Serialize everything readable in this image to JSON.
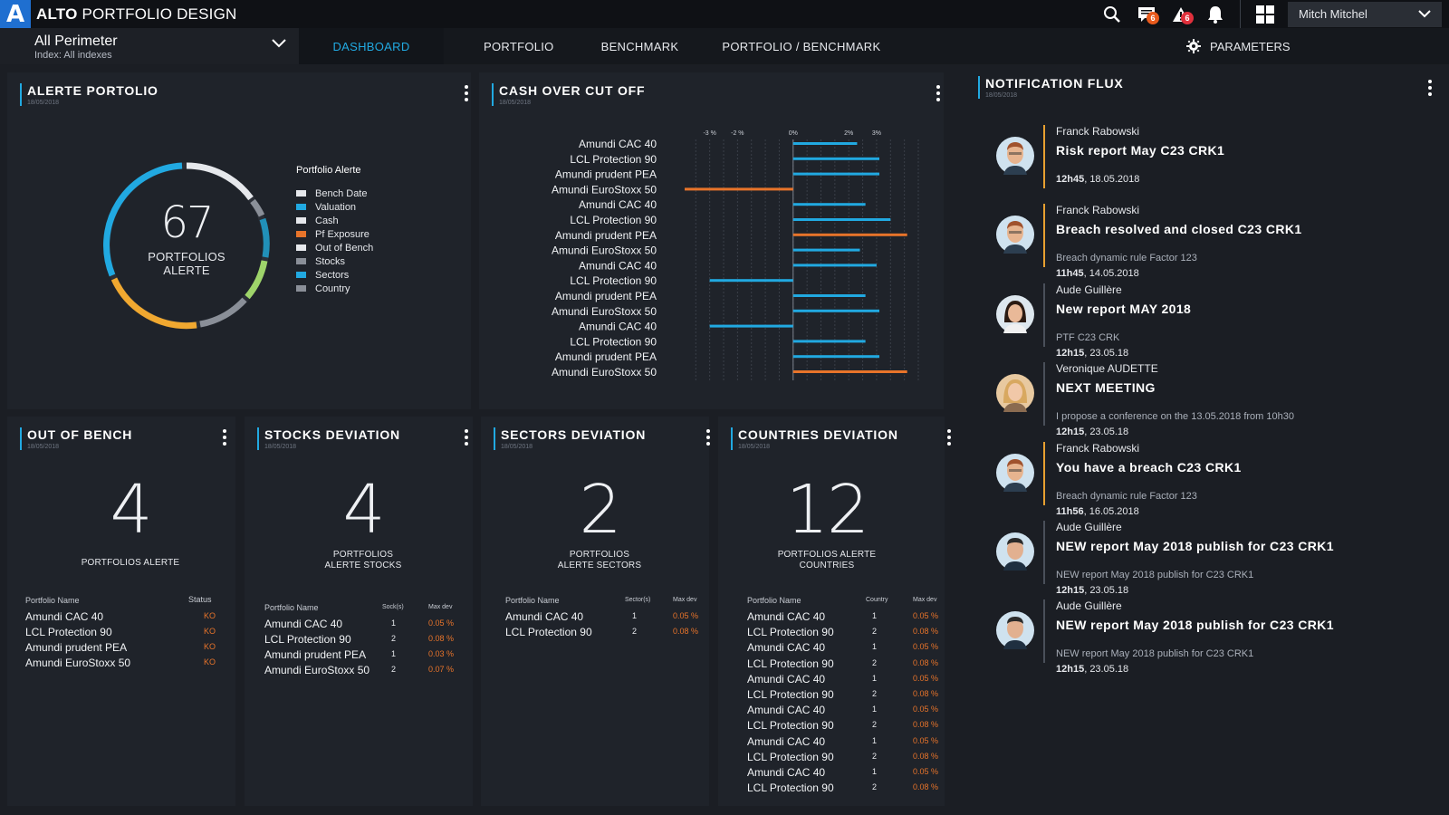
{
  "app": {
    "logo_letter": "A",
    "brand_bold": "ALTO",
    "brand_rest": "PORTFOLIO DESIGN"
  },
  "topbar": {
    "icons": [
      {
        "name": "search-icon"
      },
      {
        "name": "messages-icon",
        "badge": "6"
      },
      {
        "name": "alert-icon",
        "badge": "6"
      },
      {
        "name": "bell-icon"
      },
      {
        "name": "apps-grid-icon"
      }
    ],
    "user": "Mitch Mitchel"
  },
  "perimeter": {
    "title": "All Perimeter",
    "subtitle": "Index:  All indexes"
  },
  "nav": {
    "tabs": [
      "DASHBOARD",
      "PORTFOLIO",
      "BENCHMARK",
      "PORTFOLIO / BENCHMARK"
    ],
    "active": "DASHBOARD",
    "parameters": "PARAMETERS"
  },
  "alerte": {
    "title": "ALERTE PORTOLIO",
    "date": "18/05/2018",
    "count": "67",
    "caption1": "PORTFOLIOS",
    "caption2": "ALERTE",
    "legend_title": "Portfolio Alerte",
    "legend": [
      {
        "label": "Bench Date",
        "color": "#e6e8ec"
      },
      {
        "label": "Valuation",
        "color": "#21a9e1"
      },
      {
        "label": "Cash",
        "color": "#e6e8ec"
      },
      {
        "label": "Pf Exposure",
        "color": "#e8742a"
      },
      {
        "label": "Out of Bench",
        "color": "#e6e8ec"
      },
      {
        "label": "Stocks",
        "color": "#8a8f98"
      },
      {
        "label": "Sectors",
        "color": "#21a9e1"
      },
      {
        "label": "Country",
        "color": "#8a8f98"
      }
    ]
  },
  "cash": {
    "title": "CASH OVER CUT OFF",
    "date": "18/05/2018",
    "ticks": [
      "-3 %",
      "-2 %",
      "0%",
      "2%",
      "3%"
    ]
  },
  "chart_data": {
    "type": "bar",
    "orientation": "horizontal",
    "categories": [
      "Amundi CAC 40",
      "LCL Protection 90",
      "Amundi prudent PEA",
      "Amundi EuroStoxx 50",
      "Amundi CAC 40",
      "LCL Protection 90",
      "Amundi prudent PEA",
      "Amundi EuroStoxx 50",
      "Amundi CAC 40",
      "LCL Protection 90",
      "Amundi prudent PEA",
      "Amundi EuroStoxx 50",
      "Amundi CAC 40",
      "LCL Protection 90",
      "Amundi prudent PEA",
      "Amundi EuroStoxx 50"
    ],
    "values": [
      2.3,
      3.1,
      3.1,
      -3.9,
      2.6,
      3.5,
      4.1,
      2.4,
      3.0,
      -3.0,
      2.6,
      3.1,
      -3.0,
      2.6,
      3.1,
      4.1
    ],
    "colors": [
      "#21a9e1",
      "#21a9e1",
      "#21a9e1",
      "#e8742a",
      "#21a9e1",
      "#21a9e1",
      "#e8742a",
      "#21a9e1",
      "#21a9e1",
      "#21a9e1",
      "#21a9e1",
      "#21a9e1",
      "#21a9e1",
      "#21a9e1",
      "#21a9e1",
      "#e8742a"
    ],
    "tick_values": [
      -3,
      -2,
      0,
      2,
      3
    ],
    "tick_labels": [
      "-3 %",
      "-2 %",
      "0%",
      "2%",
      "3%"
    ],
    "xlim": [
      -3.9,
      4.5
    ],
    "title": "CASH OVER CUT OFF"
  },
  "out_of_bench": {
    "title": "OUT OF BENCH",
    "date": "18/05/2018",
    "count": "4",
    "caption": "PORTFOLIOS  ALERTE",
    "headers": [
      "Portfolio Name",
      "Status"
    ],
    "rows": [
      {
        "name": "Amundi CAC 40",
        "status": "KO"
      },
      {
        "name": "LCL Protection 90",
        "status": "KO"
      },
      {
        "name": "Amundi prudent PEA",
        "status": "KO"
      },
      {
        "name": "Amundi EuroStoxx 50",
        "status": "KO"
      }
    ]
  },
  "stocks": {
    "title": "STOCKS DEVIATION",
    "date": "18/05/2018",
    "count": "4",
    "caption1": "PORTFOLIOS",
    "caption2": "ALERTE STOCKS",
    "headers": [
      "Portfolio Name",
      "Sock(s)",
      "Max dev"
    ],
    "rows": [
      {
        "name": "Amundi CAC 40",
        "n": "1",
        "dev": "0.05 %"
      },
      {
        "name": "LCL Protection 90",
        "n": "2",
        "dev": "0.08 %"
      },
      {
        "name": "Amundi prudent PEA",
        "n": "1",
        "dev": "0.03 %"
      },
      {
        "name": "Amundi EuroStoxx 50",
        "n": "2",
        "dev": "0.07 %"
      }
    ]
  },
  "sectors": {
    "title": "SECTORS DEVIATION",
    "date": "18/05/2018",
    "count": "2",
    "caption1": "PORTFOLIOS",
    "caption2": "ALERTE SECTORS",
    "headers": [
      "Portfolio Name",
      "Sector(s)",
      "Max dev"
    ],
    "rows": [
      {
        "name": "Amundi CAC 40",
        "n": "1",
        "dev": "0.05 %"
      },
      {
        "name": "LCL Protection 90",
        "n": "2",
        "dev": "0.08 %"
      }
    ]
  },
  "countries": {
    "title": "COUNTRIES DEVIATION",
    "date": "18/05/2018",
    "count": "12",
    "caption1": "PORTFOLIOS  ALERTE",
    "caption2": "COUNTRIES",
    "headers": [
      "Portfolio Name",
      "Country",
      "Max dev"
    ],
    "rows": [
      {
        "name": "Amundi CAC 40",
        "n": "1",
        "dev": "0.05 %"
      },
      {
        "name": "LCL Protection 90",
        "n": "2",
        "dev": "0.08 %"
      },
      {
        "name": "Amundi CAC 40",
        "n": "1",
        "dev": "0.05 %"
      },
      {
        "name": "LCL Protection 90",
        "n": "2",
        "dev": "0.08 %"
      },
      {
        "name": "Amundi CAC 40",
        "n": "1",
        "dev": "0.05 %"
      },
      {
        "name": "LCL Protection 90",
        "n": "2",
        "dev": "0.08 %"
      },
      {
        "name": "Amundi CAC 40",
        "n": "1",
        "dev": "0.05 %"
      },
      {
        "name": "LCL Protection 90",
        "n": "2",
        "dev": "0.08 %"
      },
      {
        "name": "Amundi CAC 40",
        "n": "1",
        "dev": "0.05 %"
      },
      {
        "name": "LCL Protection 90",
        "n": "2",
        "dev": "0.08 %"
      },
      {
        "name": "Amundi CAC 40",
        "n": "1",
        "dev": "0.05 %"
      },
      {
        "name": "LCL Protection 90",
        "n": "2",
        "dev": "0.08 %"
      }
    ]
  },
  "notifications": {
    "title": "NOTIFICATION FLUX",
    "date": "18/05/2018",
    "items": [
      {
        "who": "Franck Rabowski",
        "title": "Risk report May C23 CRK1",
        "sub": "",
        "time_bold": "12h45",
        "time_rest": ", 18.05.2018",
        "bar": "#e8a030",
        "avatar": "man"
      },
      {
        "who": "Franck Rabowski",
        "title": "Breach resolved and closed C23 CRK1",
        "sub": "Breach dynamic rule Factor 123",
        "time_bold": "11h45",
        "time_rest": ", 14.05.2018",
        "bar": "#e8a030",
        "avatar": "man"
      },
      {
        "who": "Aude Guillère",
        "title": "New report MAY 2018",
        "sub": "PTF C23 CRK",
        "time_bold": "12h15",
        "time_rest": ", 23.05.18",
        "bar": "#4a505a",
        "avatar": "woman-dark"
      },
      {
        "who": "Veronique AUDETTE",
        "title": "NEXT MEETING",
        "sub": "I propose a conference on the 13.05.2018 from 10h30",
        "time_bold": "12h15",
        "time_rest": ", 23.05.18",
        "bar": "#4a505a",
        "avatar": "woman-blonde"
      },
      {
        "who": "Franck Rabowski",
        "title": "You have a breach C23 CRK1",
        "sub": "Breach dynamic rule Factor 123",
        "time_bold": "11h56",
        "time_rest": ", 16.05.2018",
        "bar": "#e8a030",
        "avatar": "man"
      },
      {
        "who": "Aude Guillère",
        "title": "NEW report May 2018 publish for C23 CRK1",
        "sub": "NEW report May 2018 publish for C23 CRK1",
        "time_bold": "12h15",
        "time_rest": ", 23.05.18",
        "bar": "#4a505a",
        "avatar": "man2"
      },
      {
        "who": "Aude Guillère",
        "title": "NEW report May 2018 publish for C23 CRK1",
        "sub": "NEW report May 2018 publish for C23 CRK1",
        "time_bold": "12h15",
        "time_rest": ", 23.05.18",
        "bar": "#4a505a",
        "avatar": "man2"
      }
    ]
  }
}
